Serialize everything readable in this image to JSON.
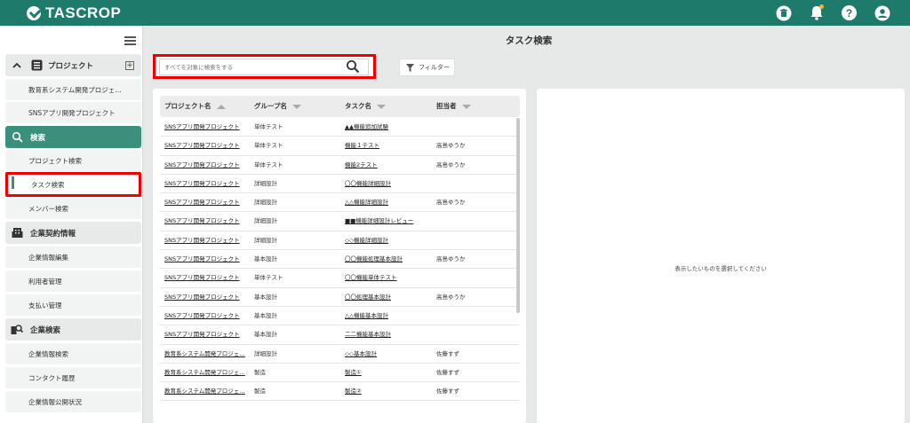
{
  "header": {
    "brand": "TASCROP",
    "icons": [
      "trash-icon",
      "bell-icon",
      "help-icon",
      "user-icon"
    ],
    "color": "#1e7a6a"
  },
  "sidebar": {
    "project_section": {
      "label": "プロジェクト",
      "items": [
        "教育系システム開発プロジェ…",
        "SNSアプリ開発プロジェクト"
      ]
    },
    "search_section": {
      "label": "検索",
      "items": [
        "プロジェクト検索",
        "タスク検索",
        "メンバー検索"
      ],
      "selected": "タスク検索"
    },
    "contract_section": {
      "label": "企業契約情報",
      "items": [
        "企業情報編集",
        "利用者管理",
        "支払い管理"
      ]
    },
    "company_search_section": {
      "label": "企業検索",
      "items": [
        "企業情報検索",
        "コンタクト履歴",
        "企業情報公開状況"
      ]
    }
  },
  "main": {
    "title": "タスク検索",
    "search_placeholder": "すべてを対象に検索をする",
    "filter_label": "フィルター",
    "columns": [
      "プロジェクト名",
      "グループ名",
      "タスク名",
      "担当者"
    ],
    "rows": [
      [
        "SNSアプリ開発プロジェクト",
        "単体テスト",
        "▲▲機能追加試験",
        ""
      ],
      [
        "SNSアプリ開発プロジェクト",
        "単体テスト",
        "機能１テスト",
        "高島ゆうか"
      ],
      [
        "SNSアプリ開発プロジェクト",
        "単体テスト",
        "機能2テスト",
        "高島ゆうか"
      ],
      [
        "SNSアプリ開発プロジェクト",
        "詳細設計",
        "〇〇機能詳細設計",
        ""
      ],
      [
        "SNSアプリ開発プロジェクト",
        "詳細設計",
        "△△機能詳細設計",
        "高島ゆうか"
      ],
      [
        "SNSアプリ開発プロジェクト",
        "詳細設計",
        "■■機能詳細設計レビュー",
        ""
      ],
      [
        "SNSアプリ開発プロジェクト",
        "詳細設計",
        "◇◇機能詳細設計",
        ""
      ],
      [
        "SNSアプリ開発プロジェクト",
        "基本設計",
        "〇〇機能処理基本設計",
        "高島ゆうか"
      ],
      [
        "SNSアプリ開発プロジェクト",
        "単体テスト",
        "〇〇機能単体テスト",
        ""
      ],
      [
        "SNSアプリ開発プロジェクト",
        "基本設計",
        "〇〇処理基本設計",
        "高島ゆうか"
      ],
      [
        "SNSアプリ開発プロジェクト",
        "基本設計",
        "△△機能基本設計",
        ""
      ],
      [
        "SNSアプリ開発プロジェクト",
        "基本設計",
        "二二機能基本設計",
        ""
      ],
      [
        "教育系システム開発プロジェ…",
        "詳細設計",
        "◇◇基本設計",
        "佐藤すず"
      ],
      [
        "教育系システム開発プロジェ…",
        "製造",
        "製造①",
        "佐藤すず"
      ],
      [
        "教育系システム開発プロジェ…",
        "製造",
        "製造②",
        "佐藤すず"
      ]
    ],
    "detail_placeholder": "表示したいものを選択してください"
  }
}
